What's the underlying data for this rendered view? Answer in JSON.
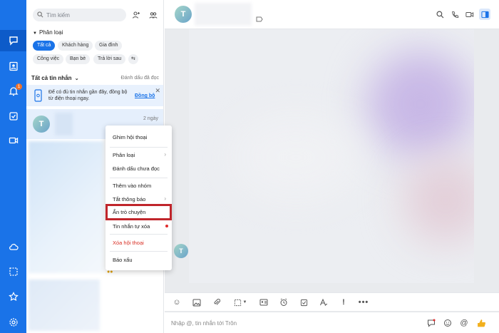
{
  "rail": {
    "notification_count": "1",
    "icons": [
      "chat-icon",
      "contacts-icon",
      "bell-icon",
      "todo-icon",
      "video-icon",
      "cloud-icon",
      "screenshot-icon",
      "star-icon",
      "settings-icon"
    ]
  },
  "sidebar": {
    "search_placeholder": "Tìm kiếm",
    "section_title": "Phân loại",
    "chips": [
      "Tất cả",
      "Khách hàng",
      "Gia đình",
      "Công việc",
      "Bạn bè",
      "Trả lời sau"
    ],
    "list_header": "Tất cả tin nhắn",
    "mark_read": "Đánh dấu đã đọc",
    "banner_text": "Để có đủ tin nhắn gần đây, đồng bộ từ điện thoại ngay.",
    "banner_link": "Đồng bộ",
    "conversation": {
      "avatar_letter": "T",
      "time": "2 ngày"
    }
  },
  "context_menu": {
    "items": [
      "Ghim hội thoại",
      "Phân loại",
      "Đánh dấu chưa đọc",
      "Thêm vào nhóm",
      "Tắt thông báo",
      "Ẩn trò chuyện",
      "Tin nhắn tự xóa",
      "Xóa hội thoại",
      "Báo xấu"
    ],
    "highlighted": "Ẩn trò chuyện",
    "highlight_color": "#c0252b"
  },
  "chat": {
    "header_avatar_letter": "T",
    "message_avatar_letter": "T",
    "composer_placeholder": "Nhập @, tin nhắn tới Trôn"
  },
  "colors": {
    "accent": "#1a73e8",
    "danger": "#d93025"
  }
}
